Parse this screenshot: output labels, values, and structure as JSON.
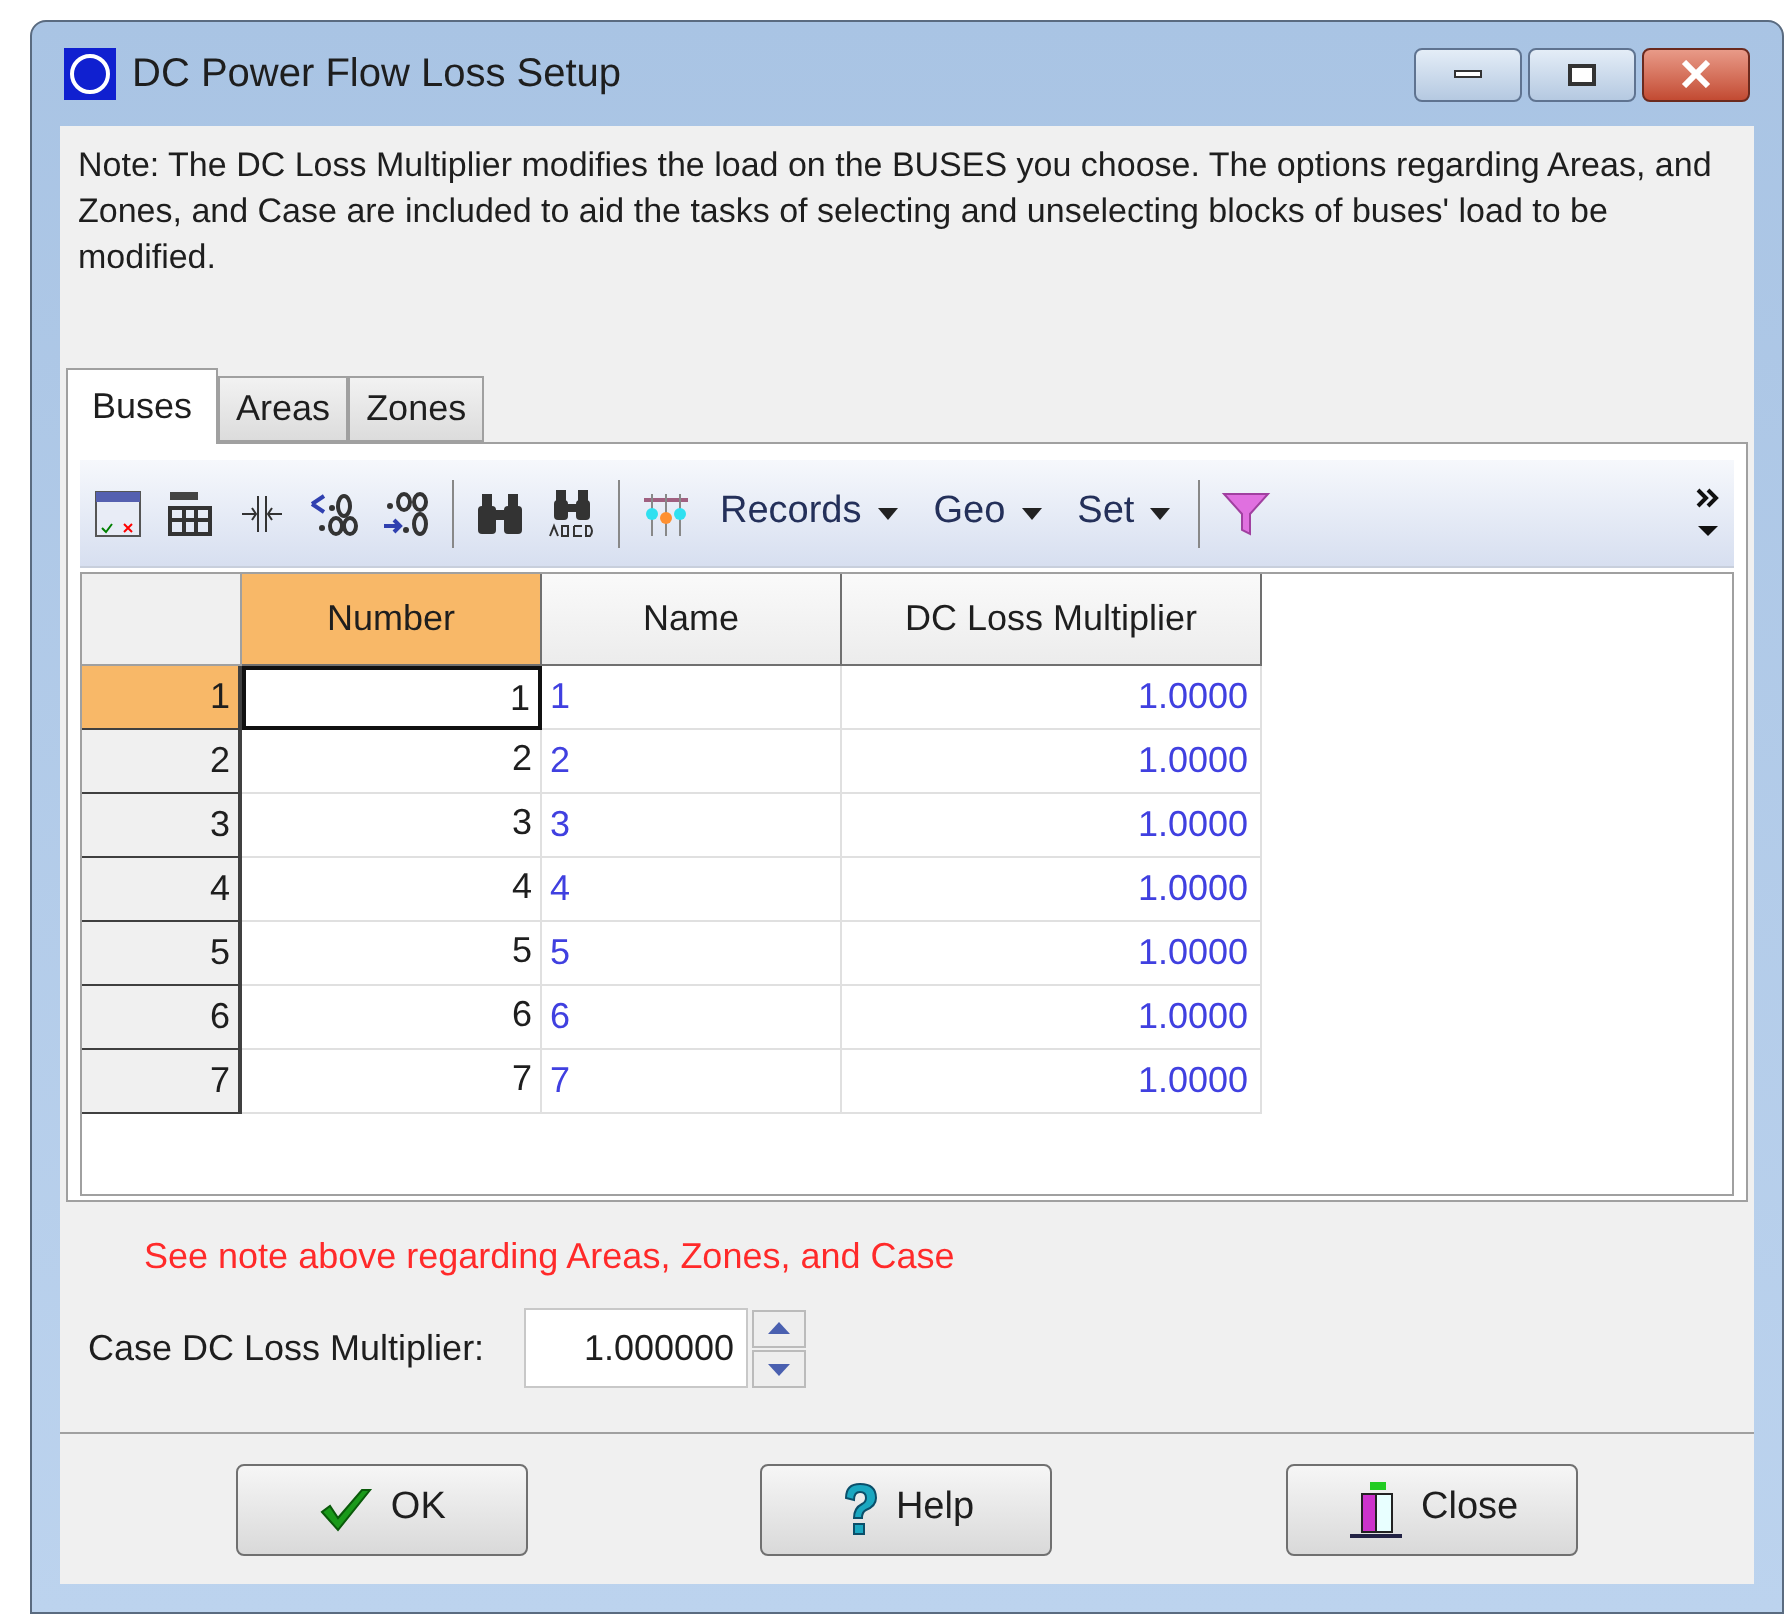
{
  "window": {
    "title": "DC Power Flow Loss Setup"
  },
  "note": "Note: The DC Loss Multiplier modifies the load on the BUSES you choose. The options regarding Areas, and Zones, and Case are included to aid the tasks of selecting and unselecting blocks of buses' load to be modified.",
  "tabs": [
    {
      "label": "Buses",
      "selected": true
    },
    {
      "label": "Areas",
      "selected": false
    },
    {
      "label": "Zones",
      "selected": false
    }
  ],
  "toolbar": {
    "menus": [
      "Records",
      "Geo",
      "Set"
    ]
  },
  "table": {
    "columns": [
      {
        "label": "Number",
        "selected": true
      },
      {
        "label": "Name",
        "selected": false
      },
      {
        "label": "DC Loss Multiplier",
        "selected": false
      }
    ],
    "rows": [
      {
        "header": "1",
        "selected": true,
        "cells": [
          "1",
          "1",
          "1.0000"
        ]
      },
      {
        "header": "2",
        "selected": false,
        "cells": [
          "2",
          "2",
          "1.0000"
        ]
      },
      {
        "header": "3",
        "selected": false,
        "cells": [
          "3",
          "3",
          "1.0000"
        ]
      },
      {
        "header": "4",
        "selected": false,
        "cells": [
          "4",
          "4",
          "1.0000"
        ]
      },
      {
        "header": "5",
        "selected": false,
        "cells": [
          "5",
          "5",
          "1.0000"
        ]
      },
      {
        "header": "6",
        "selected": false,
        "cells": [
          "6",
          "6",
          "1.0000"
        ]
      },
      {
        "header": "7",
        "selected": false,
        "cells": [
          "7",
          "7",
          "1.0000"
        ]
      }
    ]
  },
  "warning": "See note above regarding Areas, Zones, and Case",
  "case_field": {
    "label": "Case DC Loss Multiplier:",
    "value": "1.000000"
  },
  "buttons": [
    {
      "kind": "ok",
      "label": "OK"
    },
    {
      "kind": "help",
      "label": "Help"
    },
    {
      "kind": "close",
      "label": "Close"
    }
  ]
}
